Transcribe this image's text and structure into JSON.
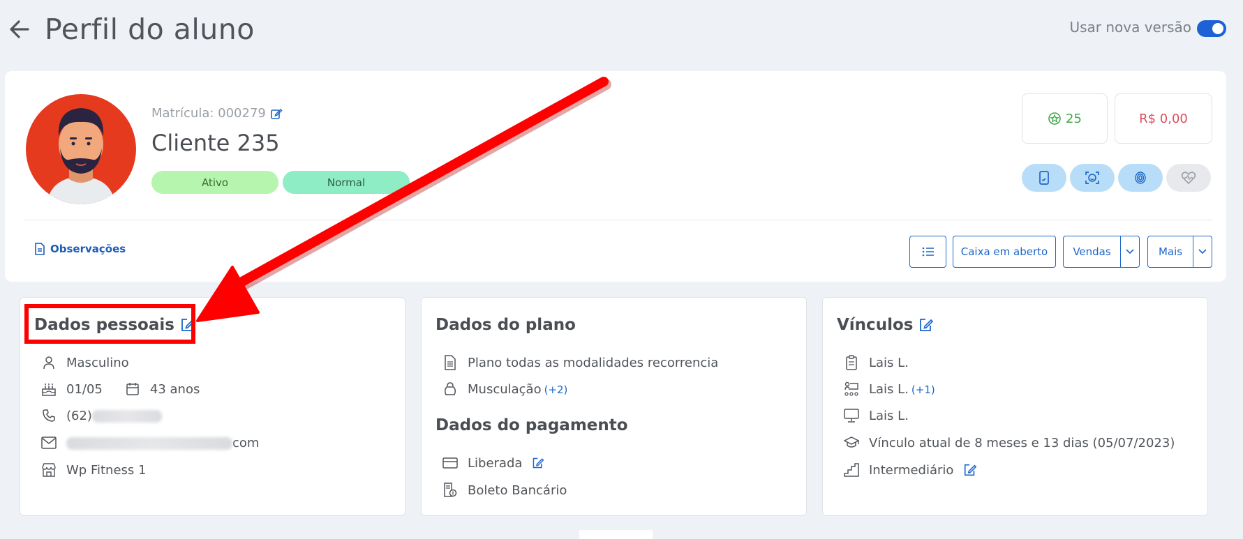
{
  "header": {
    "title": "Perfil do aluno",
    "toggle_label": "Usar nova versão",
    "toggle_on": true
  },
  "profile": {
    "matricula": "Matrícula: 000279",
    "name": "Cliente 235",
    "badges": [
      "Ativo",
      "Normal"
    ],
    "points": "25",
    "balance": "R$ 0,00",
    "observacoes": "Observações"
  },
  "actions": {
    "caixa": "Caixa em aberto",
    "vendas": "Vendas",
    "mais": "Mais"
  },
  "dados_pessoais": {
    "title": "Dados pessoais",
    "gender": "Masculino",
    "birthday": "01/05",
    "age": "43 anos",
    "phone": "(62)",
    "email_suffix": "com",
    "unit": "Wp Fitness 1"
  },
  "dados_plano": {
    "title": "Dados do plano",
    "plan": "Plano todas as modalidades recorrencia",
    "modality": "Musculação",
    "modality_extra": "(+2)",
    "payment_title": "Dados do pagamento",
    "status": "Liberada",
    "method": "Boleto Bancário"
  },
  "vinculos": {
    "title": "Vínculos",
    "consultant": "Lais L.",
    "trainer": "Lais L.",
    "trainer_extra": "(+1)",
    "teacher": "Lais L.",
    "current": "Vínculo atual de 8 meses e 13 dias (05/07/2023)",
    "level": "Intermediário"
  },
  "colors": {
    "accent": "#1c66c9",
    "annotation": "#ff0000"
  }
}
